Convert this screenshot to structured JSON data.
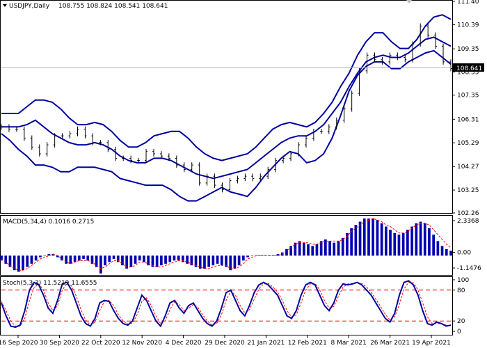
{
  "header": {
    "symbol": "USDJPY,Daily",
    "ohlc": "108.755 108.824 108.541 108.641",
    "macd_label": "MACD(5,34,4) 0.1016 0.2715",
    "stoch_label": "Stoch(5,3,3) 11.5219 11.6555"
  },
  "colors": {
    "bands": "#0000a0",
    "bars": "#0000b0",
    "signal": "#ff0000",
    "price_tag_bg": "#000000",
    "grid": "#b0b0b0"
  },
  "chart_data": {
    "type": "line",
    "title": "USDJPY,Daily",
    "x_tick_labels": [
      "16 Sep 2020",
      "30 Sep 2020",
      "22 Oct 2020",
      "12 Nov 2020",
      "4 Dec 2020",
      "29 Dec 2020",
      "21 Jan 2021",
      "12 Feb 2021",
      "8 Mar 2021",
      "26 Mar 2021",
      "19 Apr 2021"
    ],
    "price_panel": {
      "y_ticks": [
        "111.40",
        "110.39",
        "109.35",
        "108.35",
        "107.35",
        "106.31",
        "105.29",
        "104.27",
        "103.25",
        "102.26"
      ],
      "ylim": [
        102.16,
        111.6
      ],
      "current_price": "108.641",
      "upper_band": [
        106.6,
        106.6,
        106.6,
        106.9,
        107.2,
        107.2,
        107.1,
        106.8,
        106.4,
        106.1,
        106.1,
        106.2,
        106.1,
        105.8,
        105.4,
        105.1,
        105.1,
        105.3,
        105.6,
        105.7,
        105.8,
        105.8,
        105.5,
        105.1,
        104.8,
        104.6,
        104.5,
        104.6,
        104.7,
        104.8,
        105.1,
        105.5,
        105.9,
        106.1,
        106.2,
        106.1,
        106.0,
        106.2,
        106.6,
        107.1,
        107.8,
        108.4,
        109.2,
        109.8,
        110.2,
        110.2,
        109.8,
        109.5,
        109.5,
        109.9,
        110.5,
        110.9,
        111.0,
        110.8
      ],
      "middle_band": [
        106.0,
        106.0,
        106.0,
        106.1,
        106.3,
        106.0,
        105.7,
        105.5,
        105.3,
        105.2,
        105.2,
        105.3,
        105.2,
        105.0,
        104.7,
        104.5,
        104.4,
        104.4,
        104.6,
        104.6,
        104.5,
        104.3,
        104.1,
        103.9,
        103.8,
        103.7,
        103.8,
        103.9,
        104.0,
        104.1,
        104.4,
        104.7,
        105.0,
        105.3,
        105.5,
        105.6,
        105.6,
        105.8,
        106.1,
        106.6,
        107.1,
        107.8,
        108.4,
        108.9,
        109.1,
        109.2,
        109.1,
        109.1,
        109.3,
        109.6,
        109.9,
        110.0,
        109.8,
        109.6
      ],
      "lower_band": [
        105.7,
        105.4,
        105.0,
        104.7,
        104.3,
        104.3,
        104.2,
        104.0,
        104.0,
        104.2,
        104.2,
        104.2,
        104.1,
        104.0,
        103.7,
        103.6,
        103.5,
        103.4,
        103.4,
        103.4,
        103.2,
        102.9,
        102.7,
        102.7,
        102.9,
        103.1,
        103.3,
        103.1,
        103.0,
        102.9,
        103.3,
        103.8,
        104.2,
        104.6,
        104.9,
        104.8,
        104.4,
        104.5,
        104.8,
        105.5,
        106.5,
        107.6,
        108.3,
        108.7,
        108.9,
        108.9,
        108.6,
        108.6,
        108.9,
        109.1,
        109.3,
        109.4,
        109.1,
        108.8
      ],
      "close": [
        106.0,
        105.9,
        105.9,
        105.5,
        105.1,
        104.8,
        105.2,
        105.6,
        105.6,
        105.7,
        105.9,
        105.6,
        105.3,
        105.3,
        105.0,
        104.6,
        104.6,
        104.5,
        104.5,
        104.9,
        104.8,
        104.7,
        104.6,
        104.3,
        104.1,
        104.3,
        103.5,
        103.8,
        103.4,
        103.2,
        103.6,
        103.7,
        103.8,
        103.7,
        103.8,
        104.1,
        104.5,
        104.6,
        104.8,
        105.2,
        105.5,
        105.8,
        105.8,
        106.0,
        106.3,
        106.8,
        107.5,
        108.5,
        109.2,
        109.0,
        108.9,
        109.2,
        109.1,
        109.0,
        109.7,
        110.5,
        110.1,
        109.6,
        108.9,
        108.6
      ]
    },
    "macd_panel": {
      "y_ticks": [
        "2.3368",
        "0.00",
        "-1.1476"
      ],
      "ylim": [
        -1.1476,
        2.3368
      ],
      "histogram": [
        -0.3,
        -0.5,
        -0.7,
        -0.9,
        -1.0,
        -0.9,
        -0.7,
        -0.5,
        -0.3,
        -0.1,
        0.0,
        0.1,
        0.1,
        -0.1,
        -0.3,
        -0.5,
        -0.5,
        -0.4,
        -0.3,
        -0.2,
        -0.3,
        -0.5,
        -0.7,
        -1.1,
        -0.6,
        -0.4,
        -0.2,
        -0.4,
        -0.6,
        -0.8,
        -0.7,
        -0.5,
        -0.3,
        -0.4,
        -0.6,
        -0.7,
        -0.7,
        -0.6,
        -0.5,
        -0.4,
        -0.3,
        -0.3,
        -0.4,
        -0.5,
        -0.6,
        -0.7,
        -0.8,
        -0.8,
        -0.7,
        -0.6,
        -0.5,
        -0.6,
        -0.7,
        -0.9,
        -0.8,
        -0.6,
        -0.3,
        -0.1,
        0.0,
        0.0,
        0.0,
        0.0,
        0.0,
        0.0,
        0.1,
        0.2,
        0.4,
        0.6,
        0.8,
        0.9,
        0.8,
        0.7,
        0.6,
        0.7,
        0.9,
        1.0,
        0.9,
        0.8,
        0.9,
        1.1,
        1.4,
        1.7,
        1.9,
        2.1,
        2.3,
        2.3,
        2.3,
        2.2,
        2.0,
        1.8,
        1.6,
        1.4,
        1.3,
        1.4,
        1.6,
        1.8,
        2.0,
        2.1,
        2.0,
        1.7,
        1.3,
        0.9,
        0.6,
        0.4,
        0.3
      ],
      "signal": [
        -0.2,
        -0.4,
        -0.6,
        -0.8,
        -0.9,
        -0.9,
        -0.8,
        -0.6,
        -0.4,
        -0.2,
        -0.1,
        0.0,
        0.1,
        0.0,
        -0.2,
        -0.4,
        -0.5,
        -0.4,
        -0.3,
        -0.3,
        -0.3,
        -0.4,
        -0.6,
        -0.8,
        -0.7,
        -0.5,
        -0.3,
        -0.3,
        -0.5,
        -0.7,
        -0.7,
        -0.6,
        -0.4,
        -0.4,
        -0.5,
        -0.6,
        -0.7,
        -0.7,
        -0.6,
        -0.5,
        -0.4,
        -0.3,
        -0.3,
        -0.4,
        -0.5,
        -0.6,
        -0.7,
        -0.8,
        -0.8,
        -0.7,
        -0.6,
        -0.6,
        -0.6,
        -0.8,
        -0.8,
        -0.7,
        -0.5,
        -0.2,
        -0.1,
        0.0,
        0.0,
        0.0,
        0.0,
        0.0,
        0.0,
        0.1,
        0.3,
        0.5,
        0.7,
        0.8,
        0.8,
        0.8,
        0.7,
        0.7,
        0.8,
        0.9,
        0.9,
        0.9,
        0.9,
        1.0,
        1.2,
        1.5,
        1.7,
        1.9,
        2.1,
        2.2,
        2.3,
        2.2,
        2.1,
        1.9,
        1.8,
        1.6,
        1.4,
        1.4,
        1.5,
        1.7,
        1.9,
        2.0,
        2.0,
        1.9,
        1.6,
        1.3,
        1.0,
        0.7,
        0.5
      ]
    },
    "stoch_panel": {
      "y_ticks": [
        "100",
        "80",
        "20",
        "0"
      ],
      "ylim": [
        0,
        100
      ],
      "levels": [
        80,
        20
      ],
      "main": [
        55,
        30,
        10,
        8,
        12,
        40,
        80,
        95,
        90,
        70,
        45,
        35,
        60,
        92,
        95,
        80,
        55,
        30,
        15,
        10,
        25,
        55,
        60,
        58,
        40,
        25,
        15,
        12,
        20,
        45,
        70,
        60,
        40,
        20,
        10,
        30,
        55,
        60,
        45,
        35,
        50,
        55,
        40,
        25,
        15,
        10,
        20,
        45,
        75,
        80,
        60,
        40,
        30,
        50,
        75,
        90,
        95,
        90,
        80,
        70,
        50,
        30,
        25,
        40,
        70,
        90,
        95,
        90,
        70,
        50,
        40,
        55,
        80,
        92,
        90,
        92,
        95,
        90,
        80,
        70,
        55,
        40,
        25,
        18,
        35,
        70,
        95,
        98,
        90,
        70,
        40,
        15,
        12,
        18,
        15,
        10,
        12
      ],
      "signal": [
        58,
        40,
        20,
        10,
        10,
        25,
        60,
        85,
        92,
        80,
        55,
        40,
        50,
        80,
        93,
        88,
        68,
        42,
        22,
        12,
        18,
        40,
        58,
        60,
        50,
        32,
        20,
        14,
        16,
        32,
        58,
        65,
        50,
        30,
        15,
        20,
        42,
        58,
        52,
        40,
        45,
        52,
        46,
        32,
        20,
        12,
        15,
        32,
        60,
        78,
        70,
        50,
        36,
        42,
        62,
        82,
        92,
        93,
        86,
        76,
        60,
        40,
        28,
        32,
        55,
        80,
        92,
        93,
        80,
        60,
        45,
        48,
        68,
        86,
        92,
        92,
        94,
        93,
        86,
        76,
        62,
        48,
        33,
        22,
        28,
        52,
        82,
        95,
        94,
        80,
        55,
        28,
        15,
        15,
        15,
        12,
        11
      ]
    }
  }
}
